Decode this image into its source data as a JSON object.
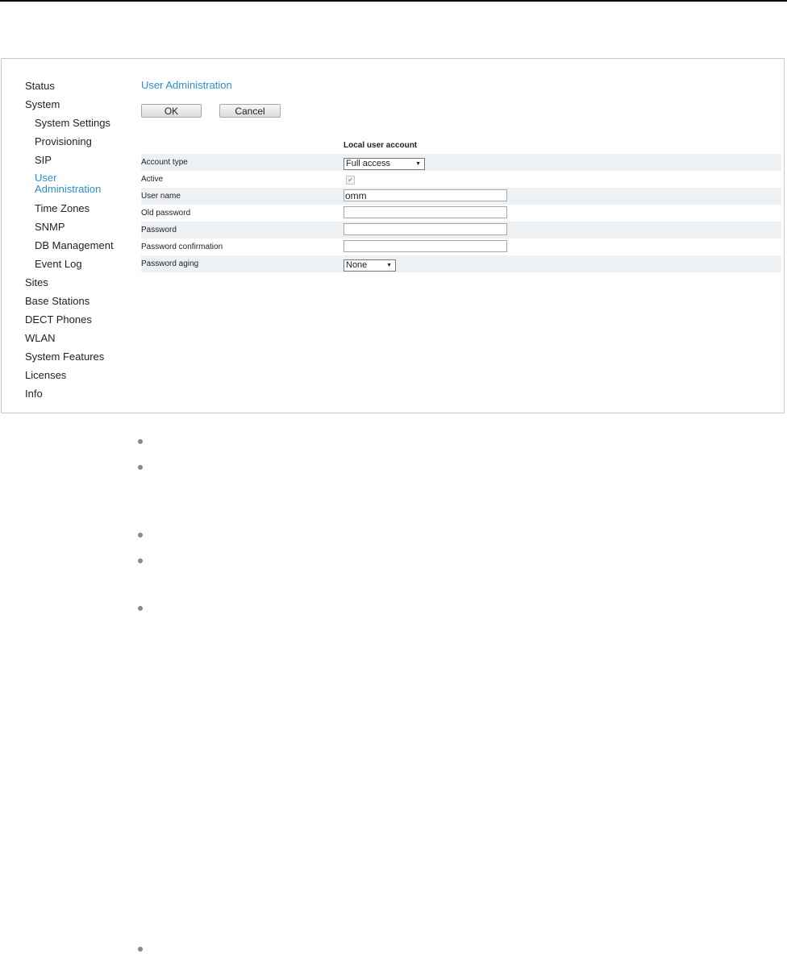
{
  "sidebar": {
    "items": [
      {
        "label": "Status"
      },
      {
        "label": "System"
      },
      {
        "label": "System Settings"
      },
      {
        "label": "Provisioning"
      },
      {
        "label": "SIP"
      },
      {
        "label": "User Administration"
      },
      {
        "label": "Time Zones"
      },
      {
        "label": "SNMP"
      },
      {
        "label": "DB Management"
      },
      {
        "label": "Event Log"
      },
      {
        "label": "Sites"
      },
      {
        "label": "Base Stations"
      },
      {
        "label": "DECT Phones"
      },
      {
        "label": "WLAN"
      },
      {
        "label": "System Features"
      },
      {
        "label": "Licenses"
      },
      {
        "label": "Info"
      }
    ]
  },
  "main": {
    "title": "User Administration",
    "buttons": {
      "ok": "OK",
      "cancel": "Cancel"
    },
    "section_header": "Local user account",
    "form": {
      "account_type": {
        "label": "Account type",
        "value": "Full access"
      },
      "active": {
        "label": "Active",
        "checked": true
      },
      "user_name": {
        "label": "User name",
        "value": "omm"
      },
      "old_password": {
        "label": "Old password",
        "value": ""
      },
      "password": {
        "label": "Password",
        "value": ""
      },
      "password_confirmation": {
        "label": "Password confirmation",
        "value": ""
      },
      "password_aging": {
        "label": "Password aging",
        "value": "None"
      }
    }
  },
  "icons": {
    "checkbox": "checkmark-icon",
    "dropdown": "chevron-down-icon",
    "bullet": "bullet-icon"
  },
  "colors": {
    "accent": "#2d8ed2",
    "row_shade": "#eef1f4",
    "frame_border": "#c9c9c9",
    "bullet": "#8a8a8a"
  }
}
